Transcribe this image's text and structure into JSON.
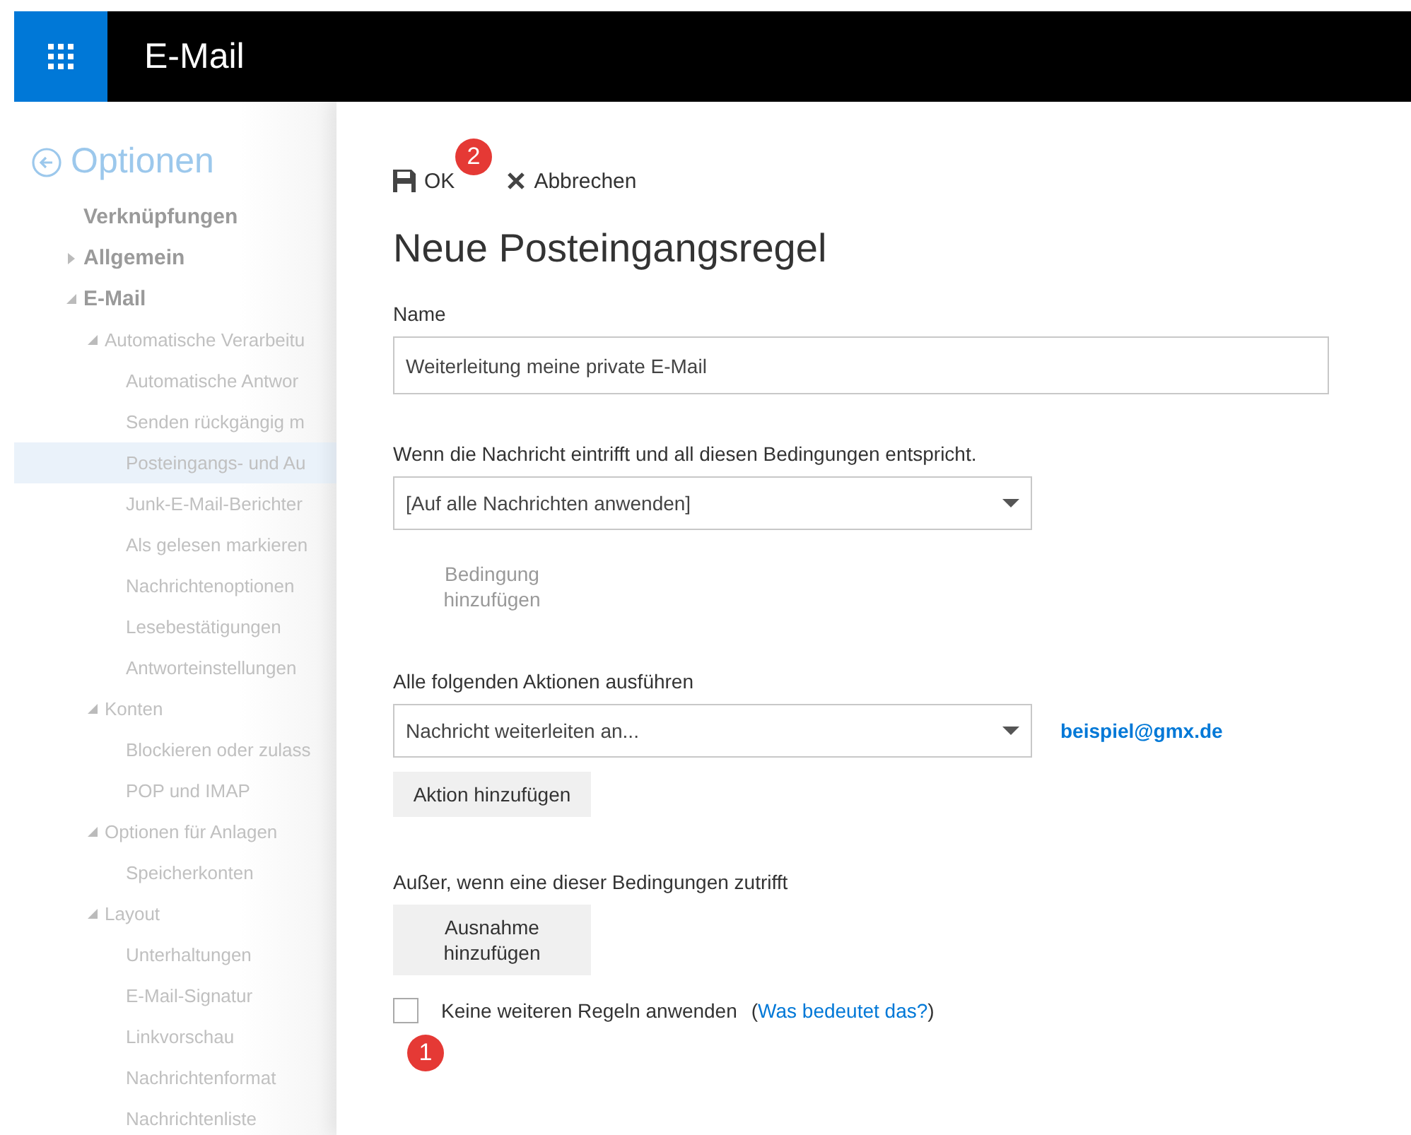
{
  "top_bar": {
    "app_title": "E-Mail"
  },
  "sidebar": {
    "title": "Optionen",
    "items": [
      {
        "label": "Verknüpfungen",
        "selected": false
      },
      {
        "label": "Allgemein",
        "expanded": false,
        "selected": false
      },
      {
        "label": "E-Mail",
        "expanded": true,
        "selected": false,
        "children": [
          {
            "label": "Automatische Verarbeitu",
            "expanded": true,
            "selected": false,
            "children": [
              {
                "label": "Automatische Antwor",
                "selected": false
              },
              {
                "label": "Senden rückgängig m",
                "selected": false
              },
              {
                "label": "Posteingangs- und Au",
                "selected": true
              },
              {
                "label": "Junk-E-Mail-Berichter",
                "selected": false
              },
              {
                "label": "Als gelesen markieren",
                "selected": false
              },
              {
                "label": "Nachrichtenoptionen",
                "selected": false
              },
              {
                "label": "Lesebestätigungen",
                "selected": false
              },
              {
                "label": "Antworteinstellungen",
                "selected": false
              }
            ]
          },
          {
            "label": "Konten",
            "expanded": true,
            "selected": false,
            "children": [
              {
                "label": "Blockieren oder zulass",
                "selected": false
              },
              {
                "label": "POP und IMAP",
                "selected": false
              }
            ]
          },
          {
            "label": "Optionen für Anlagen",
            "expanded": true,
            "selected": false,
            "children": [
              {
                "label": "Speicherkonten",
                "selected": false
              }
            ]
          },
          {
            "label": "Layout",
            "expanded": true,
            "selected": false,
            "children": [
              {
                "label": "Unterhaltungen",
                "selected": false
              },
              {
                "label": "E-Mail-Signatur",
                "selected": false
              },
              {
                "label": "Linkvorschau",
                "selected": false
              },
              {
                "label": "Nachrichtenformat",
                "selected": false
              },
              {
                "label": "Nachrichtenliste",
                "selected": false
              }
            ]
          }
        ]
      }
    ]
  },
  "toolbar": {
    "ok": "OK",
    "ok_callout": "2",
    "cancel": "Abbrechen"
  },
  "form": {
    "title": "Neue Posteingangsregel",
    "name_label": "Name",
    "name_value": "Weiterleitung meine private E-Mail",
    "condition_label": "Wenn die Nachricht eintrifft und all diesen Bedingungen entspricht.",
    "condition_value": "[Auf alle Nachrichten anwenden]",
    "add_condition": {
      "label": "Bedingung hinzufügen",
      "disabled": true
    },
    "action_label": "Alle folgenden Aktionen ausführen",
    "action_value": "Nachricht weiterleiten an...",
    "action_target": "beispiel@gmx.de",
    "add_action": {
      "label": "Aktion hinzufügen",
      "disabled": false
    },
    "exception_label": "Außer, wenn eine dieser Bedingungen zutrifft",
    "add_exception": {
      "label": "Ausnahme hinzufügen",
      "disabled": false
    },
    "stop_rules": {
      "label": "Keine weiteren Regeln anwenden",
      "checked": false,
      "callout": "1"
    },
    "help_open": "(",
    "help_link": "Was bedeutet das?",
    "help_close": ")"
  }
}
